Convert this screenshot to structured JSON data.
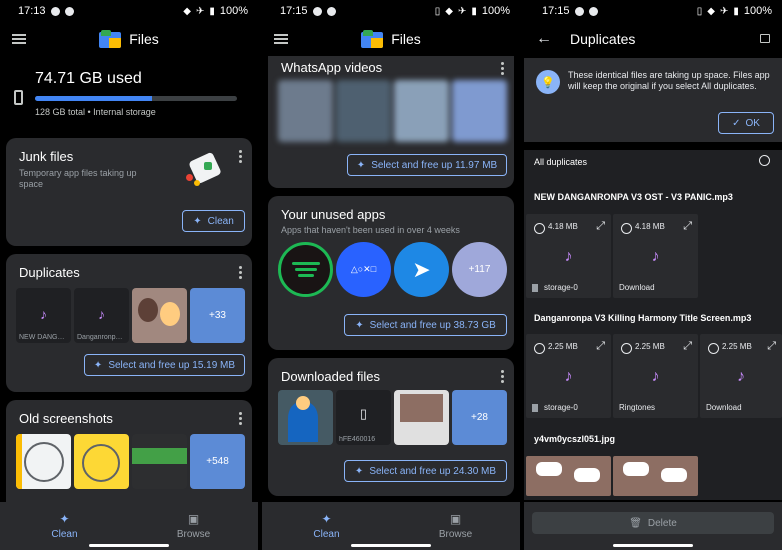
{
  "screen1": {
    "status": {
      "time": "17:13",
      "battery": "100%"
    },
    "app_title": "Files",
    "storage": {
      "used": "74.71 GB used",
      "detail": "128 GB total • Internal storage",
      "fraction_used": 0.58
    },
    "junk": {
      "title": "Junk files",
      "subtitle": "Temporary app files taking up space",
      "button": "Clean"
    },
    "duplicates": {
      "title": "Duplicates",
      "thumbs": [
        "NEW DANGAN...",
        "Danganronpa ..."
      ],
      "more": "+33",
      "button": "Select and free up 15.19 MB"
    },
    "screenshots": {
      "title": "Old screenshots",
      "more": "+548"
    },
    "nav": {
      "clean": "Clean",
      "browse": "Browse"
    }
  },
  "screen2": {
    "status": {
      "time": "17:15",
      "battery": "100%"
    },
    "app_title": "Files",
    "whatsapp": {
      "title": "WhatsApp videos",
      "button": "Select and free up 11.97 MB"
    },
    "unused": {
      "title": "Your unused apps",
      "subtitle": "Apps that haven't been used in over 4 weeks",
      "more": "+117",
      "button": "Select and free up 38.73 GB"
    },
    "downloaded": {
      "title": "Downloaded files",
      "file_label": "hFE460016",
      "more": "+28",
      "button": "Select and free up 24.30 MB"
    },
    "nav": {
      "clean": "Clean",
      "browse": "Browse"
    }
  },
  "screen3": {
    "status": {
      "time": "17:15",
      "battery": "100%"
    },
    "title": "Duplicates",
    "info": "These identical files are taking up space. Files app will keep the original if you select All duplicates.",
    "ok": "OK",
    "all_label": "All duplicates",
    "group1": {
      "name": "NEW DANGANRONPA V3 OST - V3 PANIC.mp3",
      "tiles": [
        {
          "size": "4.18 MB",
          "name": "storage-0"
        },
        {
          "size": "4.18 MB",
          "name": "Download"
        }
      ]
    },
    "group2": {
      "name": "Danganronpa V3 Killing Harmony Title Screen.mp3",
      "tiles": [
        {
          "size": "2.25 MB",
          "name": "storage-0"
        },
        {
          "size": "2.25 MB",
          "name": "Ringtones"
        },
        {
          "size": "2.25 MB",
          "name": "Download"
        }
      ]
    },
    "group3": {
      "name": "y4vm0ycszl051.jpg"
    },
    "delete": "Delete"
  },
  "colors": {
    "accent": "#8ab4f8",
    "card": "#2a2b2e",
    "music_note": "#c58af9"
  }
}
